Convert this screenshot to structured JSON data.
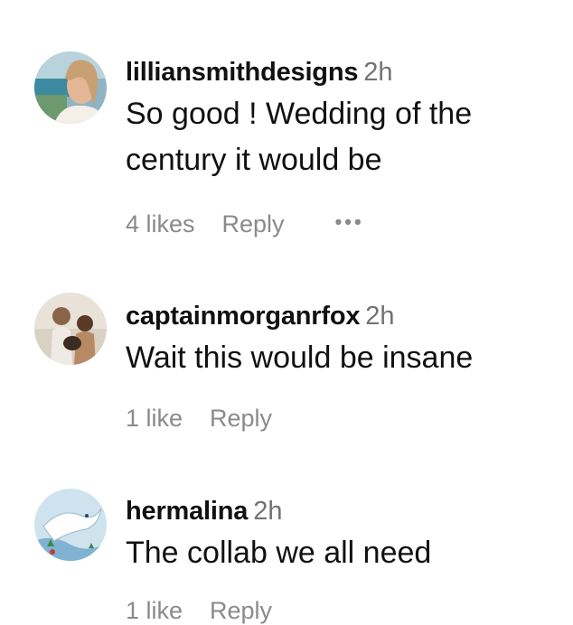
{
  "comments": [
    {
      "username": "lilliansmithdesigns",
      "time": "2h",
      "text_lines": [
        "So good ! Wedding of the",
        "century it would be"
      ],
      "likes": "4 likes",
      "reply": "Reply",
      "more": "•••"
    },
    {
      "username": "captainmorganrfox",
      "time": "2h",
      "text_lines": [
        "Wait this would be insane"
      ],
      "likes": "1 like",
      "reply": "Reply"
    },
    {
      "username": "hermalina",
      "time": "2h",
      "text_lines": [
        "The collab we all need"
      ],
      "likes": "1 like",
      "reply": "Reply"
    }
  ],
  "icons": {
    "more": "more-options-icon"
  }
}
